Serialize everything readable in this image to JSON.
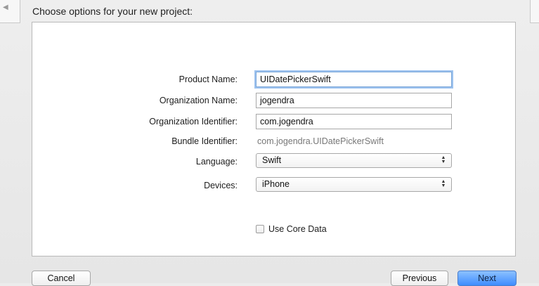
{
  "window": {
    "title": "Choose options for your new project:"
  },
  "form": {
    "fields": {
      "product_name": {
        "label": "Product Name:",
        "value": "UIDatePickerSwift"
      },
      "organization_name": {
        "label": "Organization Name:",
        "value": "jogendra"
      },
      "organization_identifier": {
        "label": "Organization Identifier:",
        "value": "com.jogendra"
      },
      "bundle_identifier": {
        "label": "Bundle Identifier:",
        "value": "com.jogendra.UIDatePickerSwift"
      },
      "language": {
        "label": "Language:",
        "selected": "Swift"
      },
      "devices": {
        "label": "Devices:",
        "selected": "iPhone"
      },
      "use_core_data": {
        "label": "Use Core Data",
        "checked": false
      }
    }
  },
  "buttons": {
    "cancel": "Cancel",
    "previous": "Previous",
    "next": "Next"
  },
  "colors": {
    "focus_ring": "#9ec3ef",
    "primary_button": "#3e8cff"
  },
  "icons": {
    "back": "left-triangle",
    "select_arrows": "up-down-chevrons"
  }
}
